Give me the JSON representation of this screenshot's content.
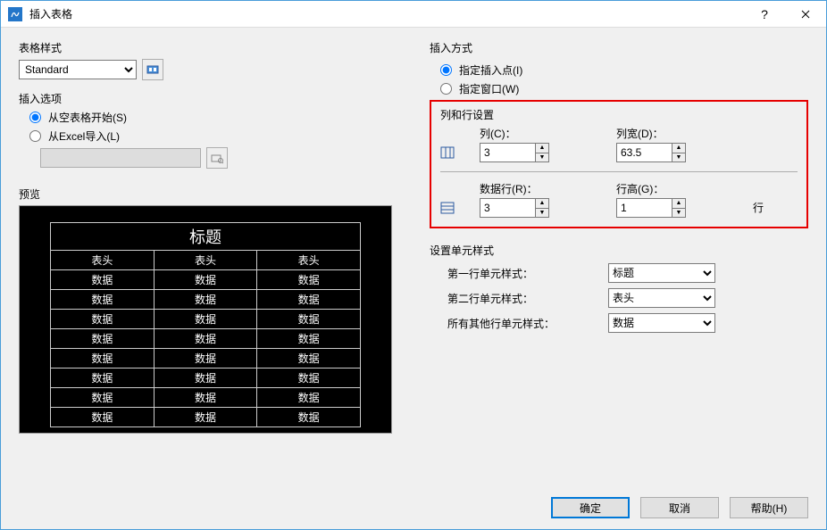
{
  "titlebar": {
    "title": "插入表格",
    "help": "?",
    "close": "✕"
  },
  "left": {
    "style_label": "表格样式",
    "style_value": "Standard",
    "options_label": "插入选项",
    "opt_empty": "从空表格开始(S)",
    "opt_excel": "从Excel导入(L)",
    "preview_label": "预览"
  },
  "right": {
    "insert_mode_label": "插入方式",
    "mode_point": "指定插入点(I)",
    "mode_window": "指定窗口(W)",
    "colrow_label": "列和行设置",
    "col_label": "列(C)：",
    "col_value": "3",
    "colw_label": "列宽(D)：",
    "colw_value": "63.5",
    "row_label": "数据行(R)：",
    "row_value": "3",
    "rowh_label": "行高(G)：",
    "rowh_value": "1",
    "row_unit": "行",
    "cellstyle_label": "设置单元样式",
    "first_row_style": "第一行单元样式：",
    "first_row_val": "标题",
    "second_row_style": "第二行单元样式：",
    "second_row_val": "表头",
    "other_row_style": "所有其他行单元样式：",
    "other_row_val": "数据"
  },
  "preview": {
    "title": "标题",
    "header": "表头",
    "data": "数据",
    "cols": 3,
    "data_rows": 8
  },
  "footer": {
    "ok": "确定",
    "cancel": "取消",
    "help": "帮助(H)"
  }
}
